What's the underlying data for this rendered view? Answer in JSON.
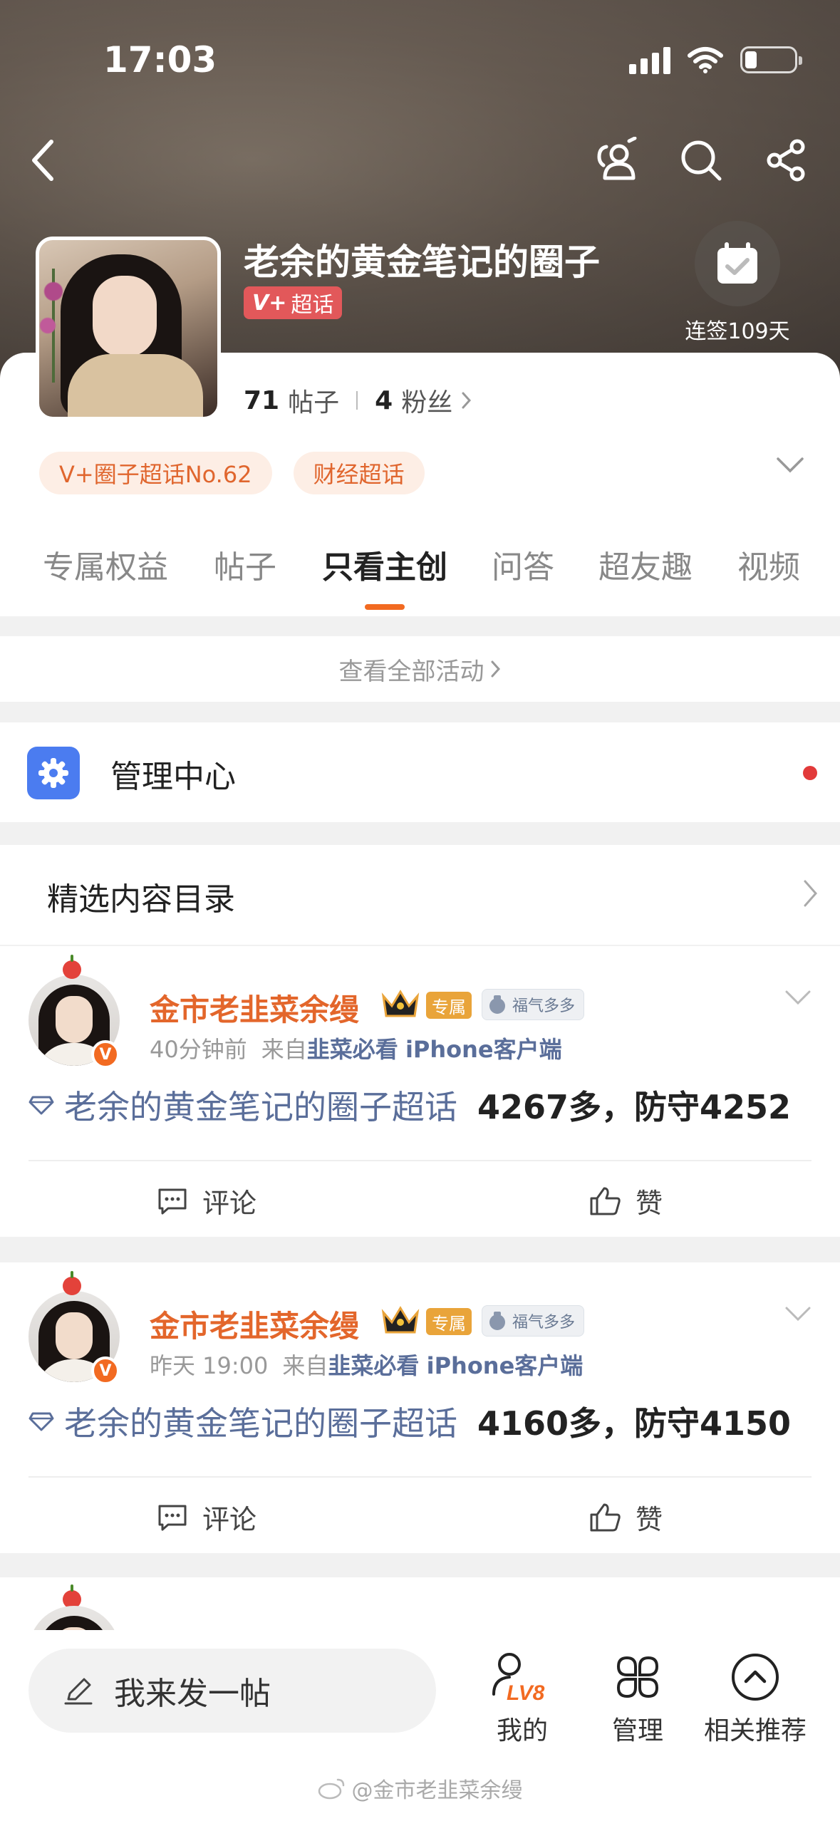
{
  "status_bar": {
    "time": "17:03"
  },
  "header": {
    "title": "老余的黄金笔记的圈子",
    "super_badge_v": "V+",
    "super_badge_label": "超话",
    "checkin_label": "连签109天"
  },
  "stats": {
    "posts_count": "71",
    "posts_label": "帖子",
    "fans_count": "4",
    "fans_label": "粉丝"
  },
  "tags": [
    "V+圈子超话No.62",
    "财经超话"
  ],
  "tabs": [
    "专属权益",
    "帖子",
    "只看主创",
    "问答",
    "超友趣",
    "视频"
  ],
  "active_tab": "只看主创",
  "view_all": "查看全部活动",
  "manage": {
    "label": "管理中心"
  },
  "catalog": {
    "label": "精选内容目录"
  },
  "posts": [
    {
      "author": "金市老韭菜余缦",
      "exclusive_badge": "专属",
      "luck_badge": "福气多多",
      "time": "40分钟前",
      "source_prefix": "来自",
      "source": "韭菜必看",
      "source_device": "iPhone客户端",
      "topic": "老余的黄金笔记的圈子超话",
      "content": "4267多，防守4252",
      "comment_label": "评论",
      "like_label": "赞"
    },
    {
      "author": "金市老韭菜余缦",
      "exclusive_badge": "专属",
      "luck_badge": "福气多多",
      "time": "昨天 19:00",
      "source_prefix": "来自",
      "source": "韭菜必看",
      "source_device": "iPhone客户端",
      "topic": "老余的黄金笔记的圈子超话",
      "content": "4160多，防守4150",
      "comment_label": "评论",
      "like_label": "赞"
    }
  ],
  "bottom_bar": {
    "post_placeholder": "我来发一帖",
    "mine_label": "我的",
    "level": "LV8",
    "manage_label": "管理",
    "related_label": "相关推荐"
  },
  "watermark": "@金市老韭菜余缦",
  "colors": {
    "accent": "#f26a21",
    "link": "#5a6e9a",
    "tag_bg": "#fdeee5"
  }
}
